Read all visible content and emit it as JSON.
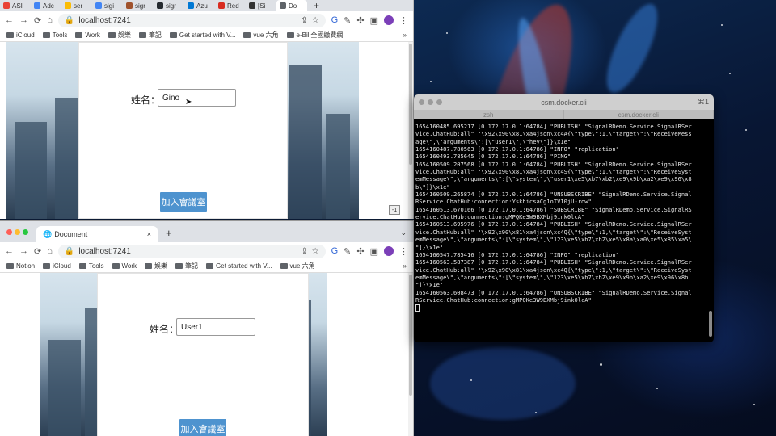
{
  "desktop": {
    "description": "space wallpaper"
  },
  "browser_top": {
    "tabs": [
      {
        "label": "ASI",
        "color": "#e94235"
      },
      {
        "label": "Adc",
        "color": "#4285f4"
      },
      {
        "label": "ser",
        "color": "#fbbc04"
      },
      {
        "label": "sigi",
        "color": "#4285f4"
      },
      {
        "label": "sigr",
        "color": "#a0522d"
      },
      {
        "label": "sigr",
        "color": "#24292f"
      },
      {
        "label": "Azu",
        "color": "#0078d4"
      },
      {
        "label": "Red",
        "color": "#d82c20"
      },
      {
        "label": "[Si",
        "color": "#333333"
      },
      {
        "label": "Do",
        "color": "#5f6368"
      }
    ],
    "new_tab": "+",
    "url": "localhost:7241",
    "bookmarks": [
      "iCloud",
      "Tools",
      "Work",
      "娛樂",
      "筆記",
      "Get started with V...",
      "vue 六角",
      "e-Bill全國繳費網"
    ],
    "bookmarks_more": "»",
    "name_label": "姓名：",
    "name_value": "Gino",
    "join_button": "加入會議室",
    "corner_badge": "-1"
  },
  "browser_bottom": {
    "tab_title": "Document",
    "tab_close": "×",
    "new_tab": "+",
    "url": "localhost:7241",
    "bookmarks": [
      "Notion",
      "iCloud",
      "Tools",
      "Work",
      "娛樂",
      "筆記",
      "Get started with V...",
      "vue 六角"
    ],
    "bookmarks_more": "»",
    "name_label": "姓名：",
    "name_value": "User1",
    "join_button": "加入會議室"
  },
  "terminal": {
    "title": "csm.docker.cli",
    "shortcut": "⌘1",
    "tabs": [
      "zsh",
      "csm.docker.cli"
    ],
    "lines": [
      "1654160485.695217 [0 172.17.0.1:64784] \"PUBLISH\" \"SignalRDemo.Service.SignalRSer",
      "vice.ChatHub:all\" \"\\x92\\x90\\x81\\xa4json\\xc4A{\\\"type\\\":1,\\\"target\\\":\\\"ReceiveMess",
      "age\\\",\\\"arguments\\\":[\\\"user1\\\",\\\"hey\\\"]}\\x1e\"",
      "1654160487.780563 [0 172.17.0.1:64786] \"INFO\" \"replication\"",
      "1654160493.785645 [0 172.17.0.1:64786] \"PING\"",
      "1654160509.207568 [0 172.17.0.1:64784] \"PUBLISH\" \"SignalRDemo.Service.SignalRSer",
      "vice.ChatHub:all\" \"\\x92\\x90\\x81\\xa4json\\xc4S{\\\"type\\\":1,\\\"target\\\":\\\"ReceiveSyst",
      "emMessage\\\",\\\"arguments\\\":[\\\"system\\\",\\\"user1\\xe5\\xb7\\xb2\\xe9\\x9b\\xa2\\xe9\\x96\\x8",
      "b\\\"]}\\x1e\"",
      "1654160509.265874 [0 172.17.0.1:64786] \"UNSUBSCRIBE\" \"SignalRDemo.Service.Signal",
      "RService.ChatHub:connection:YskhicsaCg1oTVI0jU-row\"",
      "1654160513.670166 [0 172.17.0.1:64786] \"SUBSCRIBE\" \"SignalRDemo.Service.SignalRS",
      "ervice.ChatHub:connection:gMPQKe3W9BXMbj9ink0lcA\"",
      "1654160513.695976 [0 172.17.0.1:64784] \"PUBLISH\" \"SignalRDemo.Service.SignalRSer",
      "vice.ChatHub:all\" \"\\x92\\x90\\x81\\xa4json\\xc4Q{\\\"type\\\":1,\\\"target\\\":\\\"ReceiveSyst",
      "emMessage\\\",\\\"arguments\\\":[\\\"system\\\",\\\"123\\xe5\\xb7\\xb2\\xe5\\x8a\\xa0\\xe5\\x85\\xa5\\",
      "\"]}\\x1e\"",
      "1654160547.785416 [0 172.17.0.1:64786] \"INFO\" \"replication\"",
      "1654160563.587387 [0 172.17.0.1:64784] \"PUBLISH\" \"SignalRDemo.Service.SignalRSer",
      "vice.ChatHub:all\" \"\\x92\\x90\\x81\\xa4json\\xc4Q{\\\"type\\\":1,\\\"target\\\":\\\"ReceiveSyst",
      "emMessage\\\",\\\"arguments\\\":[\\\"system\\\",\\\"123\\xe5\\xb7\\xb2\\xe9\\x9b\\xa2\\xe9\\x96\\x8b",
      "\"]}\\x1e\"",
      "1654160563.608473 [0 172.17.0.1:64786] \"UNSUBSCRIBE\" \"SignalRDemo.Service.Signal",
      "RService.ChatHub:connection:gMPQKe3W9BXMbj9ink0lcA\""
    ]
  }
}
